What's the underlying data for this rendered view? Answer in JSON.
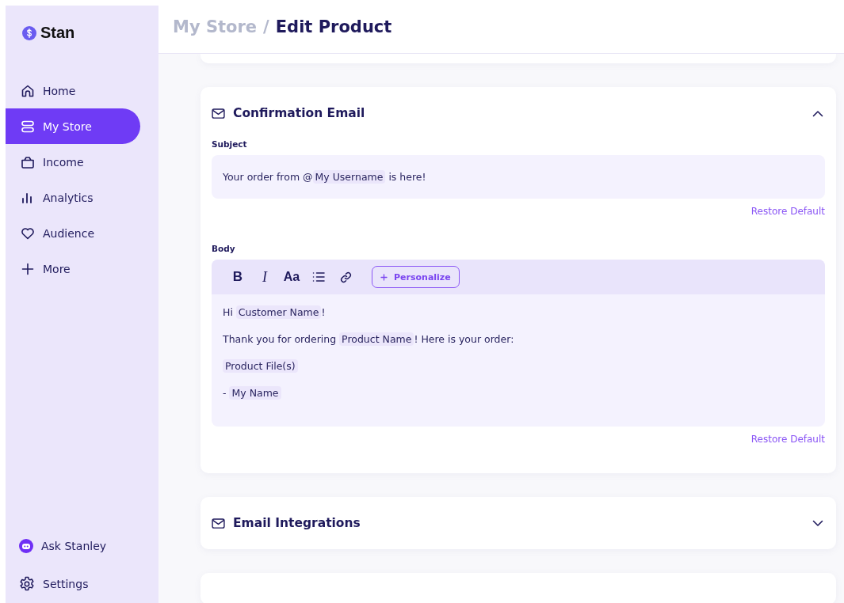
{
  "brand": {
    "name": "Stan"
  },
  "sidebar": {
    "items": [
      {
        "label": "Home",
        "kind": "home",
        "selected": false
      },
      {
        "label": "My Store",
        "kind": "store",
        "selected": true
      },
      {
        "label": "Income",
        "kind": "bag",
        "selected": false
      },
      {
        "label": "Analytics",
        "kind": "bars",
        "selected": false
      },
      {
        "label": "Audience",
        "kind": "heart",
        "selected": false
      },
      {
        "label": "More",
        "kind": "plus",
        "selected": false
      }
    ],
    "bottom_items": [
      {
        "label": "Ask Stanley",
        "kind": "bot"
      },
      {
        "label": "Settings",
        "kind": "gear"
      }
    ]
  },
  "breadcrumb": {
    "parent": "My Store",
    "separator": "/",
    "current": "Edit Product"
  },
  "sections": [
    {
      "title": "Confirmation Email",
      "expanded": true,
      "subject": {
        "label": "Subject",
        "segments": [
          {
            "kind": "text",
            "text": "Your order from @"
          },
          {
            "kind": "token",
            "text": "My Username"
          },
          {
            "kind": "text",
            "text": " is here!"
          }
        ],
        "restore": "Restore Default"
      },
      "body": {
        "label": "Body",
        "toolbar": [
          "B",
          "I",
          "Aa"
        ],
        "personalize": "Personalize",
        "lines": [
          [
            {
              "kind": "text",
              "text": "Hi "
            },
            {
              "kind": "token",
              "text": "Customer Name"
            },
            {
              "kind": "text",
              "text": "!"
            }
          ],
          [
            {
              "kind": "text",
              "text": "Thank you for ordering "
            },
            {
              "kind": "token",
              "text": "Product Name"
            },
            {
              "kind": "text",
              "text": "! Here is your order:"
            }
          ],
          [
            {
              "kind": "token",
              "text": "Product File(s)"
            }
          ],
          [
            {
              "kind": "text",
              "text": "- "
            },
            {
              "kind": "token",
              "text": "My Name"
            }
          ]
        ],
        "restore": "Restore Default"
      }
    },
    {
      "title": "Email Integrations",
      "expanded": false
    }
  ]
}
